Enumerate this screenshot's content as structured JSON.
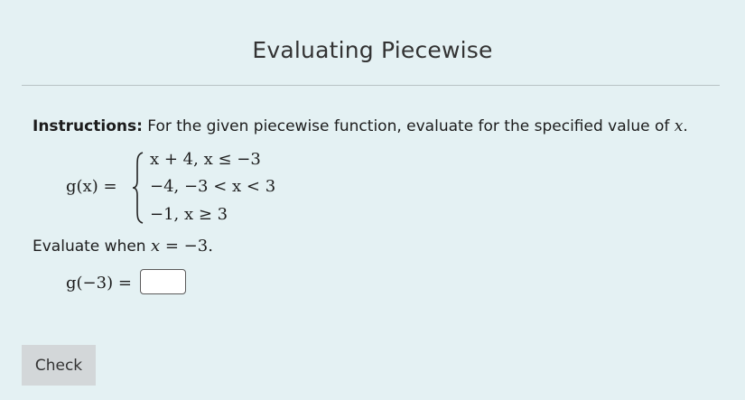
{
  "title": "Evaluating Piecewise",
  "instructions": {
    "label": "Instructions:",
    "text": " For the given piecewise function, evaluate for the specified value of ",
    "var": "x",
    "end": "."
  },
  "function": {
    "lhs": "g(x) =",
    "cases": [
      "x + 4,  x ≤ −3",
      "−4,  −3 < x < 3",
      "−1,  x ≥ 3"
    ]
  },
  "evaluate": {
    "prefix": "Evaluate when ",
    "var": "x",
    "value": " = −3."
  },
  "answer": {
    "label": "g(−3) =",
    "input_value": ""
  },
  "check_button": "Check"
}
